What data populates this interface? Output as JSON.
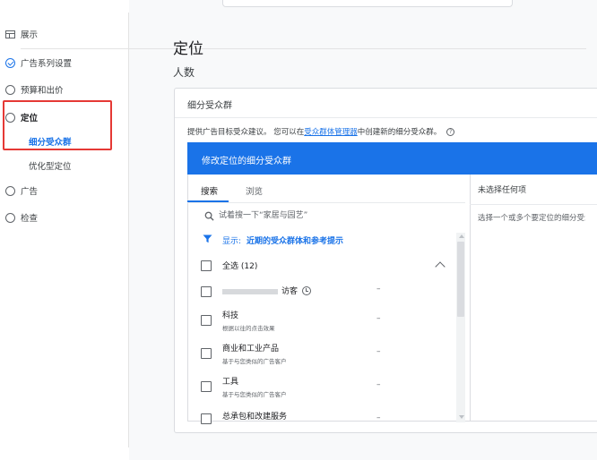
{
  "sidebar": {
    "items": [
      {
        "label": "展示",
        "icon": "overview-icon"
      },
      {
        "label": "广告系列设置",
        "icon": "check-circle-icon"
      },
      {
        "label": "预算和出价",
        "icon": "circle-icon"
      },
      {
        "label": "定位",
        "icon": "circle-icon"
      },
      {
        "label": "细分受众群",
        "icon": ""
      },
      {
        "label": "优化型定位",
        "icon": ""
      },
      {
        "label": "广告",
        "icon": "circle-icon"
      },
      {
        "label": "检查",
        "icon": "circle-icon"
      }
    ]
  },
  "main": {
    "title": "定位",
    "subtitle": "人数"
  },
  "card": {
    "header": "细分受众群",
    "desc_prefix": "提供广告目标受众建议。 您可以在",
    "desc_link": "受众群体管理器",
    "desc_suffix": "中创建新的细分受众群。",
    "help": "?",
    "blue_bar_title": "修改定位的细分受众群",
    "tabs": [
      {
        "label": "搜索"
      },
      {
        "label": "浏览"
      }
    ],
    "search": {
      "placeholder": "试着搜一下“家居与园艺”"
    },
    "filter": {
      "label": "显示:",
      "value": "近期的受众群体和参考提示"
    },
    "select_all": "全选 (12)",
    "rows": [
      {
        "title": "访客",
        "sub": "",
        "dash": "–"
      },
      {
        "title": "科技",
        "sub": "根据以往的点击效果",
        "dash": "–"
      },
      {
        "title": "商业和工业产品",
        "sub": "基于与您类似的广告客户",
        "dash": "–"
      },
      {
        "title": "工具",
        "sub": "基于与您类似的广告客户",
        "dash": "–"
      },
      {
        "title": "总承包和改建服务",
        "sub": "",
        "dash": "–"
      }
    ],
    "right": {
      "title": "未选择任何项",
      "hint": "选择一个或多个要定位的细分受众群"
    }
  },
  "colors": {
    "accent": "#1a73e8",
    "highlight": "#e53935"
  }
}
